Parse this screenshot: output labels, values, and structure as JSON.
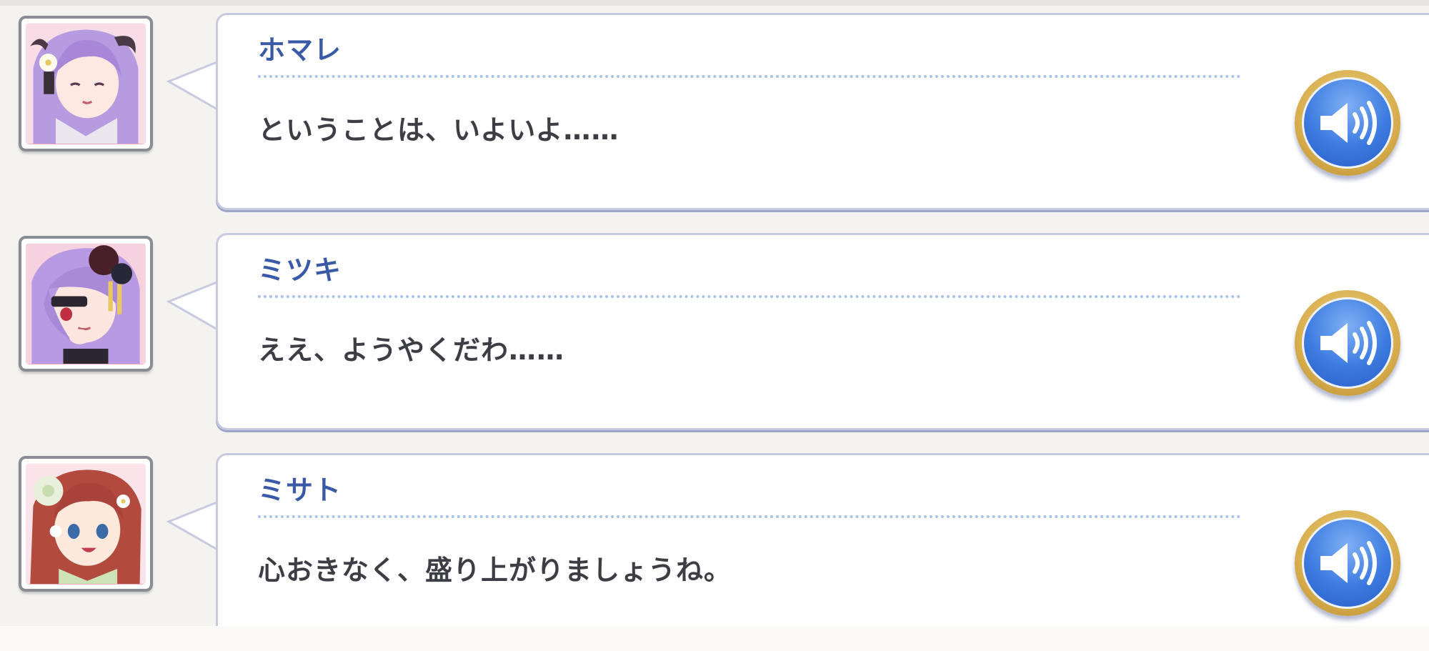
{
  "log": {
    "entries": [
      {
        "speaker": "ホマレ",
        "text": "ということは、いよいよ……",
        "portrait_icon": "homare-portrait",
        "voice_icon": "speaker-volume-icon"
      },
      {
        "speaker": "ミツキ",
        "text": "ええ、ようやくだわ……",
        "portrait_icon": "mitsuki-portrait",
        "voice_icon": "speaker-volume-icon"
      },
      {
        "speaker": "ミサト",
        "text": "心おきなく、盛り上がりましょうね。",
        "portrait_icon": "misato-portrait",
        "voice_icon": "speaker-volume-icon"
      }
    ]
  },
  "colors": {
    "background": "#f4f3ef",
    "name": "#3a5aa8",
    "text": "#3d3d45",
    "voice_button": "#3c7be0",
    "voice_rim": "#d8ae4e"
  }
}
